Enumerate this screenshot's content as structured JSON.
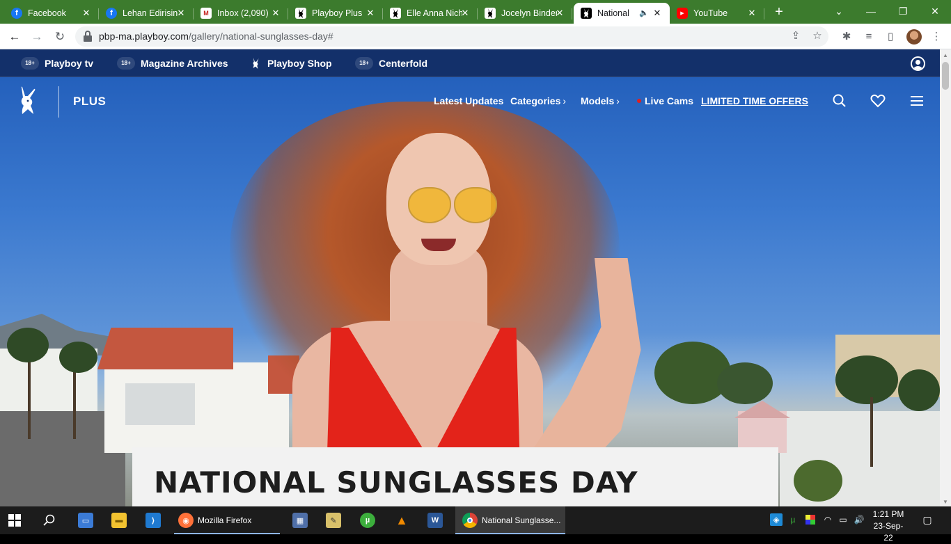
{
  "browser": {
    "tabs": [
      {
        "title": "Facebook",
        "favicon": "facebook-icon",
        "active": false
      },
      {
        "title": "Lehan Edirisinghe",
        "favicon": "facebook-icon",
        "active": false
      },
      {
        "title": "Inbox (2,090)",
        "favicon": "gmail-icon",
        "active": false
      },
      {
        "title": "Playboy Plus",
        "favicon": "playboy-bunny-icon",
        "active": false
      },
      {
        "title": "Elle Anna Nichole",
        "favicon": "playboy-bunny-icon",
        "active": false
      },
      {
        "title": "Jocelyn Binder",
        "favicon": "playboy-bunny-icon",
        "active": false
      },
      {
        "title": "National Sunglasses Day",
        "favicon": "playboy-bunny-icon",
        "active": true,
        "audio": true
      },
      {
        "title": "YouTube",
        "favicon": "youtube-icon",
        "active": false
      }
    ],
    "url_host": "pbp-ma.playboy.com",
    "url_path": "/gallery/national-sunglasses-day#"
  },
  "site": {
    "topbar": [
      {
        "label": "Playboy tv",
        "badge": "18+"
      },
      {
        "label": "Magazine Archives",
        "badge": "18+"
      },
      {
        "label": "Playboy Shop",
        "badge": ""
      },
      {
        "label": "Centerfold",
        "badge": "18+"
      }
    ],
    "brand": "PLUS",
    "nav": {
      "latest": "Latest Updates",
      "categories": "Categories",
      "models": "Models",
      "live": "Live Cams",
      "offers": "LIMITED TIME OFFERS"
    },
    "gallery_title": "NATIONAL SUNGLASSES DAY"
  },
  "taskbar": {
    "firefox_label": "Mozilla Firefox",
    "chrome_label": "National Sunglasse...",
    "time": "1:21 PM",
    "date": "23-Sep-22"
  },
  "colors": {
    "tabstrip": "#3c7b2d",
    "sitebar": "#13306a",
    "bikini": "#e3231a"
  }
}
